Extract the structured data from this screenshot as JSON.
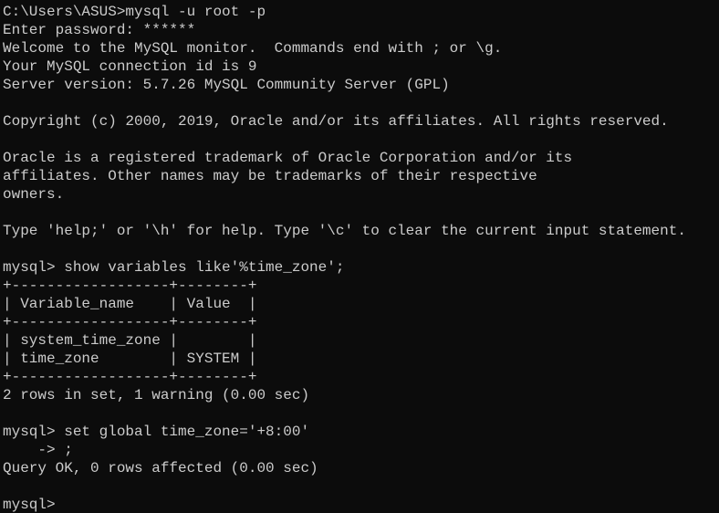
{
  "terminal": {
    "background_color": "#0c0c0c",
    "text_color": "#cccccc",
    "lines": [
      "C:\\Users\\ASUS>mysql -u root -p",
      "Enter password: ******",
      "Welcome to the MySQL monitor.  Commands end with ; or \\g.",
      "Your MySQL connection id is 9",
      "Server version: 5.7.26 MySQL Community Server (GPL)",
      "",
      "Copyright (c) 2000, 2019, Oracle and/or its affiliates. All rights reserved.",
      "",
      "Oracle is a registered trademark of Oracle Corporation and/or its",
      "affiliates. Other names may be trademarks of their respective",
      "owners.",
      "",
      "Type 'help;' or '\\h' for help. Type '\\c' to clear the current input statement.",
      "",
      "mysql> show variables like'%time_zone';",
      "+------------------+--------+",
      "| Variable_name    | Value  |",
      "+------------------+--------+",
      "| system_time_zone |        |",
      "| time_zone        | SYSTEM |",
      "+------------------+--------+",
      "2 rows in set, 1 warning (0.00 sec)",
      "",
      "mysql> set global time_zone='+8:00'",
      "    -> ;",
      "Query OK, 0 rows affected (0.00 sec)",
      "",
      "mysql>"
    ]
  }
}
